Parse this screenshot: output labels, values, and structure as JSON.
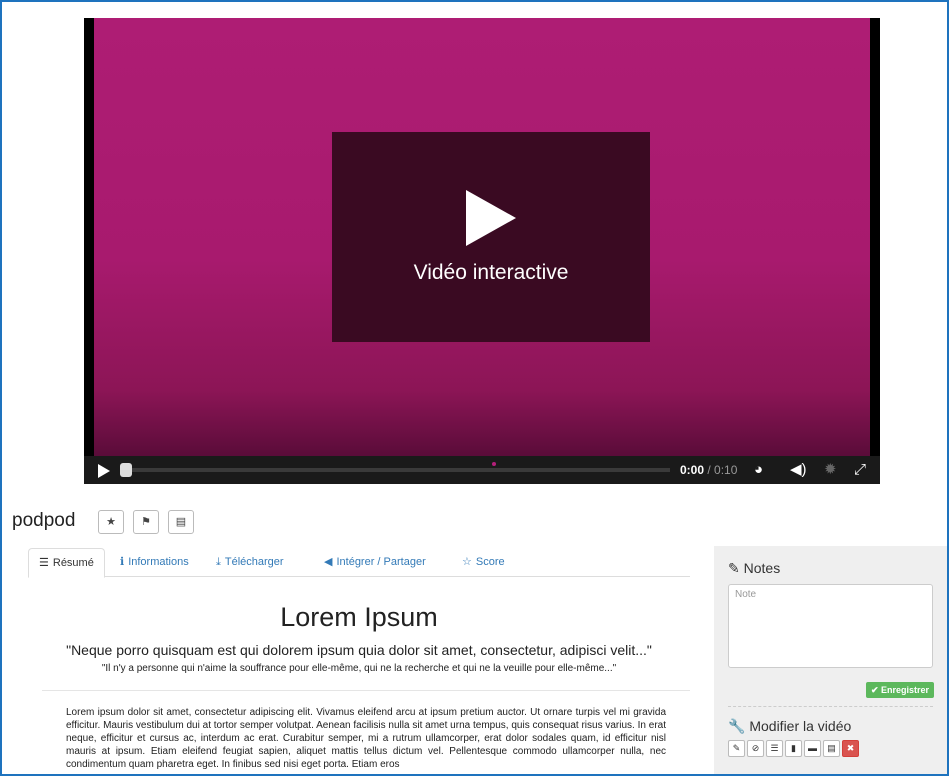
{
  "player": {
    "overlay_title": "Vidéo interactive",
    "current_time": "0:00",
    "duration": "/ 0:10",
    "progress": 0.0,
    "icons": [
      "play-icon",
      "dashboard-icon",
      "volume-icon",
      "settings-icon",
      "fullscreen-icon"
    ]
  },
  "video": {
    "title": "podpod",
    "action_icons": [
      "star-icon",
      "flag-icon",
      "film-icon"
    ],
    "action_glyphs": [
      "★",
      "⚑",
      "▤"
    ]
  },
  "tabs": [
    {
      "label": "Résumé",
      "icon": "list-icon",
      "glyph": "☰"
    },
    {
      "label": "Informations",
      "icon": "info-icon",
      "glyph": "ℹ"
    },
    {
      "label": "Télécharger",
      "icon": "download-icon",
      "glyph": "⤓"
    },
    {
      "label": "Intégrer / Partager",
      "icon": "share-icon",
      "glyph": "◀"
    },
    {
      "label": "Score",
      "icon": "star-outline-icon",
      "glyph": "☆"
    }
  ],
  "content": {
    "title": "Lorem Ipsum",
    "quote_latin": "\"Neque porro quisquam est qui dolorem ipsum quia dolor sit amet, consectetur, adipisci velit...\"",
    "quote_french": "\"Il n'y a personne qui n'aime la souffrance pour elle-même, qui ne la recherche et qui ne la veuille pour elle-même...\"",
    "body": "Lorem ipsum dolor sit amet, consectetur adipiscing elit. Vivamus eleifend arcu at ipsum pretium auctor. Ut ornare turpis vel mi gravida efficitur. Mauris vestibulum dui at tortor semper volutpat. Aenean facilisis nulla sit amet urna tempus, quis consequat risus varius. In erat neque, efficitur et cursus ac, interdum ac erat. Curabitur semper, mi a rutrum ullamcorper, erat dolor sodales quam, id efficitur nisl mauris at ipsum. Etiam eleifend feugiat sapien, aliquet mattis tellus dictum vel. Pellentesque commodo ullamcorper nulla, nec condimentum quam pharetra eget. In finibus sed nisi eget porta. Etiam eros"
  },
  "notes": {
    "title": "Notes",
    "placeholder": "Note",
    "save_label": "✔ Enregistrer",
    "edit_title": "Modifier la vidéo",
    "edit_icons": [
      "pencil-icon",
      "paperclip-icon",
      "list-icon",
      "file-icon",
      "board-icon",
      "film-icon",
      "delete-icon"
    ],
    "edit_glyphs": [
      "✎",
      "⊘",
      "☰",
      "▮",
      "▬",
      "▤",
      "✖"
    ]
  },
  "colors": {
    "video_magenta": "#ae1d74",
    "frame_blue": "#1e73be",
    "link_blue": "#337ab7",
    "success_green": "#5cb85c",
    "danger_red": "#d9534f"
  }
}
